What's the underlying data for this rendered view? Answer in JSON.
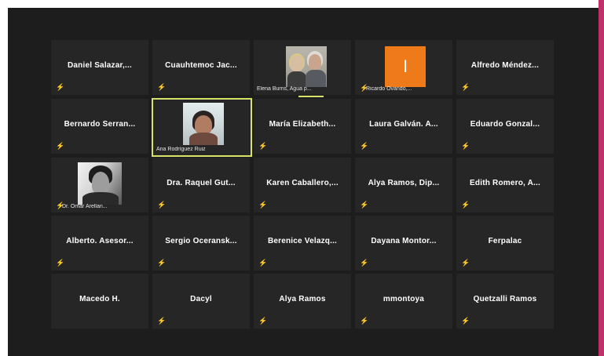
{
  "participants": [
    {
      "name": "Daniel  Salazar,...",
      "muted": true,
      "video": false
    },
    {
      "name": "Cuauhtemoc  Jac...",
      "muted": true,
      "video": false
    },
    {
      "name": "Elena Burns, Agua p...",
      "muted": false,
      "video": true,
      "photo": "two-people",
      "speaking": true
    },
    {
      "name": "Ricardo Ovando,...",
      "muted": true,
      "video": true,
      "photo": "orange-avatar",
      "avatar_letter": "I"
    },
    {
      "name": "Alfredo  Méndez...",
      "muted": true,
      "video": false
    },
    {
      "name": "Bernardo  Serran...",
      "muted": true,
      "video": false
    },
    {
      "name": "Ana Rodríguez Ruiz",
      "muted": false,
      "video": true,
      "photo": "woman",
      "active": true
    },
    {
      "name": "María  Elizabeth...",
      "muted": true,
      "video": false
    },
    {
      "name": "Laura  Galván.  A...",
      "muted": true,
      "video": false
    },
    {
      "name": "Eduardo  Gonzal...",
      "muted": true,
      "video": false
    },
    {
      "name": "Dr. Omar Arellan...",
      "muted": true,
      "video": true,
      "photo": "man-bw"
    },
    {
      "name": "Dra.  Raquel  Gut...",
      "muted": true,
      "video": false
    },
    {
      "name": "Karen  Caballero,...",
      "muted": true,
      "video": false
    },
    {
      "name": "Alya  Ramos,  Dip...",
      "muted": true,
      "video": false
    },
    {
      "name": "Edith  Romero,  A...",
      "muted": true,
      "video": false
    },
    {
      "name": "Alberto.  Asesor...",
      "muted": true,
      "video": false
    },
    {
      "name": "Sergio  Oceransk...",
      "muted": true,
      "video": false
    },
    {
      "name": "Berenice  Velazq...",
      "muted": true,
      "video": false
    },
    {
      "name": "Dayana  Montor...",
      "muted": true,
      "video": false
    },
    {
      "name": "Ferpalac",
      "muted": true,
      "video": false
    },
    {
      "name": "Macedo H.",
      "muted": false,
      "video": false
    },
    {
      "name": "Dacyl",
      "muted": true,
      "video": false
    },
    {
      "name": "Alya Ramos",
      "muted": true,
      "video": false
    },
    {
      "name": "mmontoya",
      "muted": true,
      "video": false
    },
    {
      "name": "Quetzalli Ramos",
      "muted": true,
      "video": false
    }
  ],
  "colors": {
    "background": "#1d1d1d",
    "tile": "#262626",
    "active_border": "#d8e26a",
    "mute_icon": "#e43b3b",
    "accent_bar": "#c0306a"
  }
}
